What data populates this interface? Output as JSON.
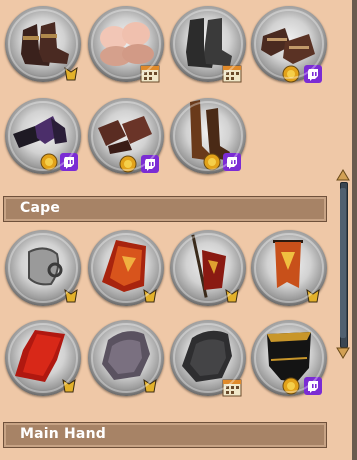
{
  "sections": {
    "cape_label": "Cape",
    "main_hand_label": "Main Hand"
  },
  "colors": {
    "background": "#efc8a7",
    "section_bar": "#a78366",
    "twitch": "#7b2cd4",
    "coin": "#e2a21a",
    "calendar": "#f0e7c8"
  },
  "boots_row1": [
    {
      "name": "brown-boots-icon",
      "badge": "medal"
    },
    {
      "name": "fur-boots-icon",
      "badge": "calendar"
    },
    {
      "name": "dark-metal-boots-icon",
      "badge": "calendar"
    },
    {
      "name": "sandal-boots-icon",
      "badge": "coin-twitch"
    }
  ],
  "boots_row2": [
    {
      "name": "purple-shoes-icon",
      "badge": "coin-twitch"
    },
    {
      "name": "leather-shoes-icon",
      "badge": "coin-twitch"
    },
    {
      "name": "tall-boots-icon",
      "badge": "coin-twitch"
    }
  ],
  "cape_row1": [
    {
      "name": "hook-cape-icon",
      "badge": "medal"
    },
    {
      "name": "red-banner-cape-icon",
      "badge": "medal"
    },
    {
      "name": "red-spear-banner-icon",
      "badge": "medal"
    },
    {
      "name": "orange-banner-icon",
      "badge": "medal"
    }
  ],
  "cape_row2": [
    {
      "name": "red-cape-icon",
      "badge": "medal"
    },
    {
      "name": "grey-feather-cape-icon",
      "badge": "medal"
    },
    {
      "name": "dark-feather-cape-icon",
      "badge": "calendar"
    },
    {
      "name": "black-gold-cape-icon",
      "badge": "coin-twitch"
    }
  ]
}
